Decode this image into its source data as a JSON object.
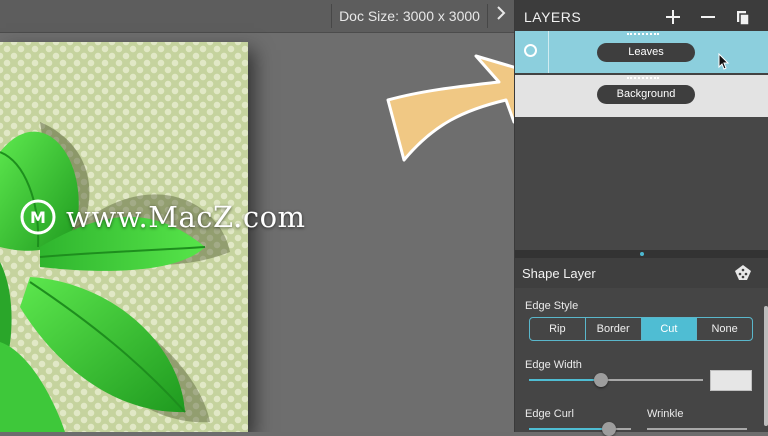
{
  "toolbar": {
    "doc_size": "Doc Size: 3000 x 3000",
    "expand_icon": "chevron-right-icon"
  },
  "watermark": {
    "text": "www.MacZ.com",
    "logo_letter": "M"
  },
  "layers_panel": {
    "title": "LAYERS",
    "add_icon": "plus-icon",
    "remove_icon": "minus-icon",
    "duplicate_icon": "duplicate-icon",
    "layers": [
      {
        "name": "Leaves",
        "selected": true
      },
      {
        "name": "Background",
        "selected": false
      }
    ]
  },
  "shape_layer": {
    "title": "Shape Layer",
    "edge_style": {
      "label": "Edge Style",
      "options": [
        "Rip",
        "Border",
        "Cut",
        "None"
      ],
      "selected": "Cut"
    },
    "edge_width": {
      "label": "Edge Width",
      "value_fraction": 0.42
    },
    "edge_curl": {
      "label": "Edge Curl",
      "value_fraction": 0.8
    },
    "wrinkle": {
      "label": "Wrinkle"
    }
  },
  "colors": {
    "accent": "#4fbdd3",
    "selected_layer": "#8ccfdd",
    "leaf_green": "#3ec83a",
    "arrow_fill": "#f0c884"
  }
}
